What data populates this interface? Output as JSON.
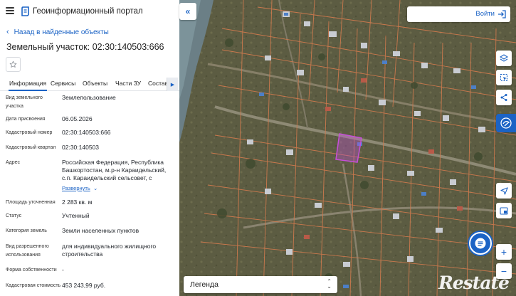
{
  "header": {
    "app_title": "Геоинформационный портал"
  },
  "nav": {
    "back_label": "Назад в найденные объекты"
  },
  "object": {
    "title": "Земельный участок: 02:30:140503:666"
  },
  "tabs": [
    {
      "label": "Информация",
      "active": true
    },
    {
      "label": "Сервисы",
      "active": false
    },
    {
      "label": "Объекты",
      "active": false
    },
    {
      "label": "Части ЗУ",
      "active": false
    },
    {
      "label": "Состав",
      "active": false
    }
  ],
  "fields": {
    "land_type": {
      "label": "Вид земельного участка",
      "value": "Землепользование"
    },
    "assign_date": {
      "label": "Дата присвоения",
      "value": "06.05.2026"
    },
    "cad_number": {
      "label": "Кадастровый номер",
      "value": "02:30:140503:666"
    },
    "cad_quarter": {
      "label": "Кадастровый квартал",
      "value": "02:30:140503"
    },
    "address": {
      "label": "Адрес",
      "value": "Российская Федерация, Республика Башкортостан, м.р-н Караидельский, с.п. Караидельский сельсовет, с",
      "more": "Развернуть"
    },
    "area": {
      "label": "Площадь уточненная",
      "value": "2 283 кв. м"
    },
    "status": {
      "label": "Статус",
      "value": "Учтенный"
    },
    "category": {
      "label": "Категория земель",
      "value": "Земли населенных пунктов"
    },
    "permitted_use": {
      "label": "Вид разрешенного использования",
      "value": "для индивидуального жилищного строительства"
    },
    "ownership": {
      "label": "Форма собственности",
      "value": "-"
    },
    "cad_value": {
      "label": "Кадастровая стоимость",
      "value": "453 243,99 руб."
    }
  },
  "map": {
    "login_label": "Войти",
    "legend_label": "Легенда",
    "watermark": "Restate",
    "colors": {
      "parcel_lines": "#d07a4e",
      "selected_parcel": "#c64fd9",
      "accent": "#1b63c5"
    }
  }
}
